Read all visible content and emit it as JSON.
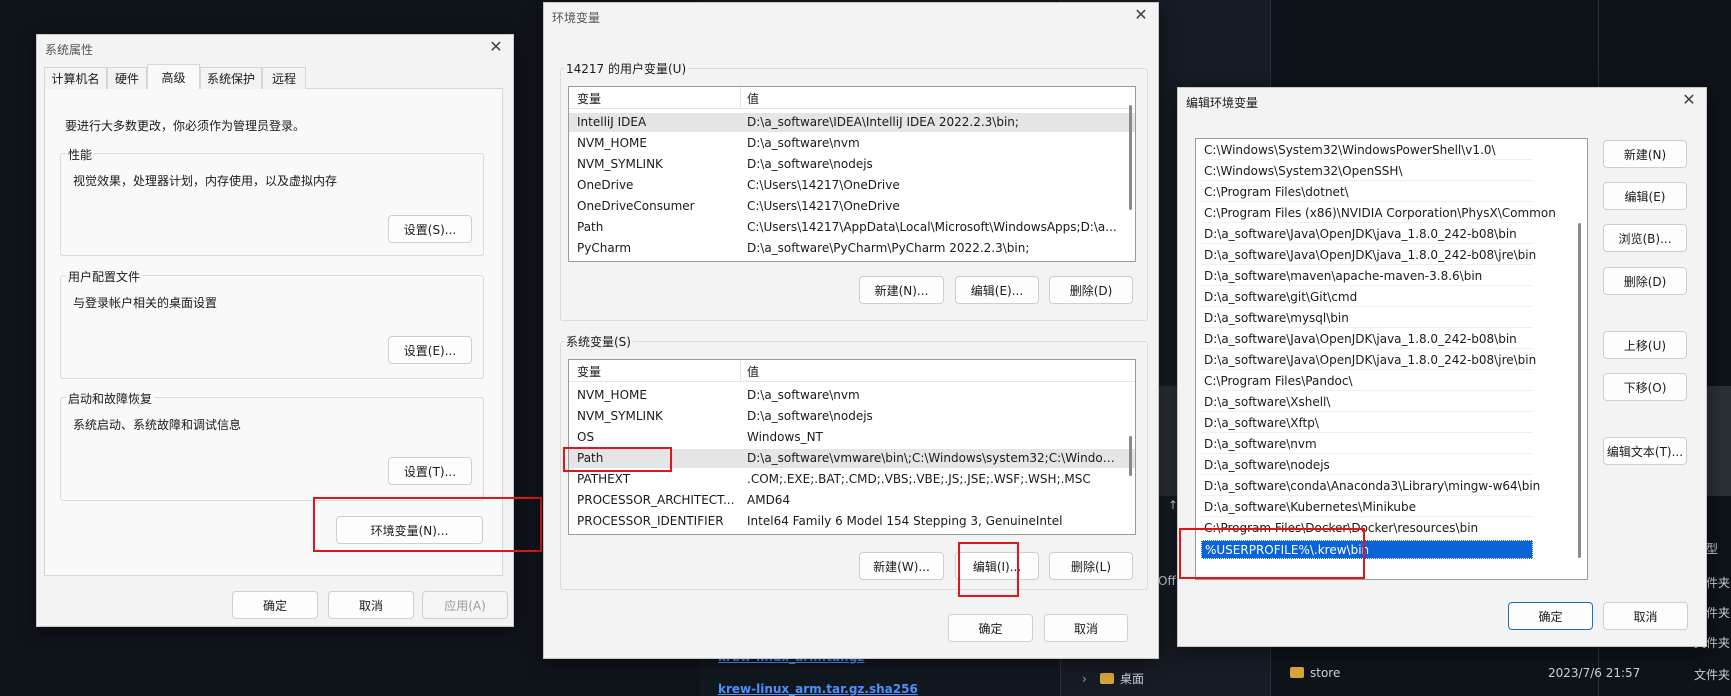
{
  "background": {
    "files": [
      {
        "name": "krew-linux_arm.tar.gz"
      },
      {
        "name": "krew-linux_arm.tar.gz.sha256"
      }
    ],
    "tree_item": "桌面",
    "folder": {
      "name": "store",
      "date": "2023/7/6 21:57",
      "type": "文件夹"
    },
    "side_fragments": [
      "型",
      "文件夹",
      "文件夹",
      "文件夹"
    ],
    "left_fragment": "Off",
    "arrow_fragment": "↑"
  },
  "sysprops": {
    "title": "系统属性",
    "tabs": [
      "计算机名",
      "硬件",
      "高级",
      "系统保护",
      "远程"
    ],
    "active_tab": "高级",
    "admin_note": "要进行大多数更改，你必须作为管理员登录。",
    "groups": [
      {
        "title": "性能",
        "desc": "视觉效果，处理器计划，内存使用，以及虚拟内存",
        "button": "设置(S)..."
      },
      {
        "title": "用户配置文件",
        "desc": "与登录帐户相关的桌面设置",
        "button": "设置(E)..."
      },
      {
        "title": "启动和故障恢复",
        "desc": "系统启动、系统故障和调试信息",
        "button": "设置(T)..."
      }
    ],
    "env_button": "环境变量(N)...",
    "ok": "确定",
    "cancel": "取消",
    "apply": "应用(A)"
  },
  "envvars": {
    "title": "环境变量",
    "user_section": "14217 的用户变量(U)",
    "sys_section": "系统变量(S)",
    "col_var": "变量",
    "col_val": "值",
    "user_rows": [
      {
        "name": "IntelliJ IDEA",
        "value": "D:\\a_software\\IDEA\\IntelliJ IDEA 2022.2.3\\bin;"
      },
      {
        "name": "NVM_HOME",
        "value": "D:\\a_software\\nvm"
      },
      {
        "name": "NVM_SYMLINK",
        "value": "D:\\a_software\\nodejs"
      },
      {
        "name": "OneDrive",
        "value": "C:\\Users\\14217\\OneDrive"
      },
      {
        "name": "OneDriveConsumer",
        "value": "C:\\Users\\14217\\OneDrive"
      },
      {
        "name": "Path",
        "value": "C:\\Users\\14217\\AppData\\Local\\Microsoft\\WindowsApps;D:\\a..."
      },
      {
        "name": "PyCharm",
        "value": "D:\\a_software\\PyCharm\\PyCharm 2022.2.3\\bin;"
      }
    ],
    "sys_rows": [
      {
        "name": "NVM_HOME",
        "value": "D:\\a_software\\nvm"
      },
      {
        "name": "NVM_SYMLINK",
        "value": "D:\\a_software\\nodejs"
      },
      {
        "name": "OS",
        "value": "Windows_NT"
      },
      {
        "name": "Path",
        "value": "D:\\a_software\\vmware\\bin\\;C:\\Windows\\system32;C:\\Window..."
      },
      {
        "name": "PATHEXT",
        "value": ".COM;.EXE;.BAT;.CMD;.VBS;.VBE;.JS;.JSE;.WSF;.WSH;.MSC"
      },
      {
        "name": "PROCESSOR_ARCHITECT...",
        "value": "AMD64"
      },
      {
        "name": "PROCESSOR_IDENTIFIER",
        "value": "Intel64 Family 6 Model 154 Stepping 3, GenuineIntel"
      }
    ],
    "selected_sys_row": "Path",
    "user_buttons": [
      "新建(N)...",
      "编辑(E)...",
      "删除(D)"
    ],
    "sys_buttons": [
      "新建(W)...",
      "编辑(I)...",
      "删除(L)"
    ],
    "ok": "确定",
    "cancel": "取消"
  },
  "editenv": {
    "title": "编辑环境变量",
    "items": [
      "C:\\Windows\\System32\\WindowsPowerShell\\v1.0\\",
      "C:\\Windows\\System32\\OpenSSH\\",
      "C:\\Program Files\\dotnet\\",
      "C:\\Program Files (x86)\\NVIDIA Corporation\\PhysX\\Common",
      "D:\\a_software\\Java\\OpenJDK\\java_1.8.0_242-b08\\bin",
      "D:\\a_software\\Java\\OpenJDK\\java_1.8.0_242-b08\\jre\\bin",
      "D:\\a_software\\maven\\apache-maven-3.8.6\\bin",
      "D:\\a_software\\git\\Git\\cmd",
      "D:\\a_software\\mysql\\bin",
      "D:\\a_software\\Java\\OpenJDK\\java_1.8.0_242-b08\\bin",
      "D:\\a_software\\Java\\OpenJDK\\java_1.8.0_242-b08\\jre\\bin",
      "C:\\Program Files\\Pandoc\\",
      "D:\\a_software\\Xshell\\",
      "D:\\a_software\\Xftp\\",
      "D:\\a_software\\nvm",
      "D:\\a_software\\nodejs",
      "D:\\a_software\\conda\\Anaconda3\\Library\\mingw-w64\\bin",
      "D:\\a_software\\Kubernetes\\Minikube",
      "C:\\Program Files\\Docker\\Docker\\resources\\bin",
      "%USERPROFILE%\\.krew\\bin"
    ],
    "selected_index": 19,
    "buttons": [
      "新建(N)",
      "编辑(E)",
      "浏览(B)...",
      "删除(D)",
      "上移(U)",
      "下移(O)",
      "编辑文本(T)..."
    ],
    "ok": "确定",
    "cancel": "取消"
  }
}
